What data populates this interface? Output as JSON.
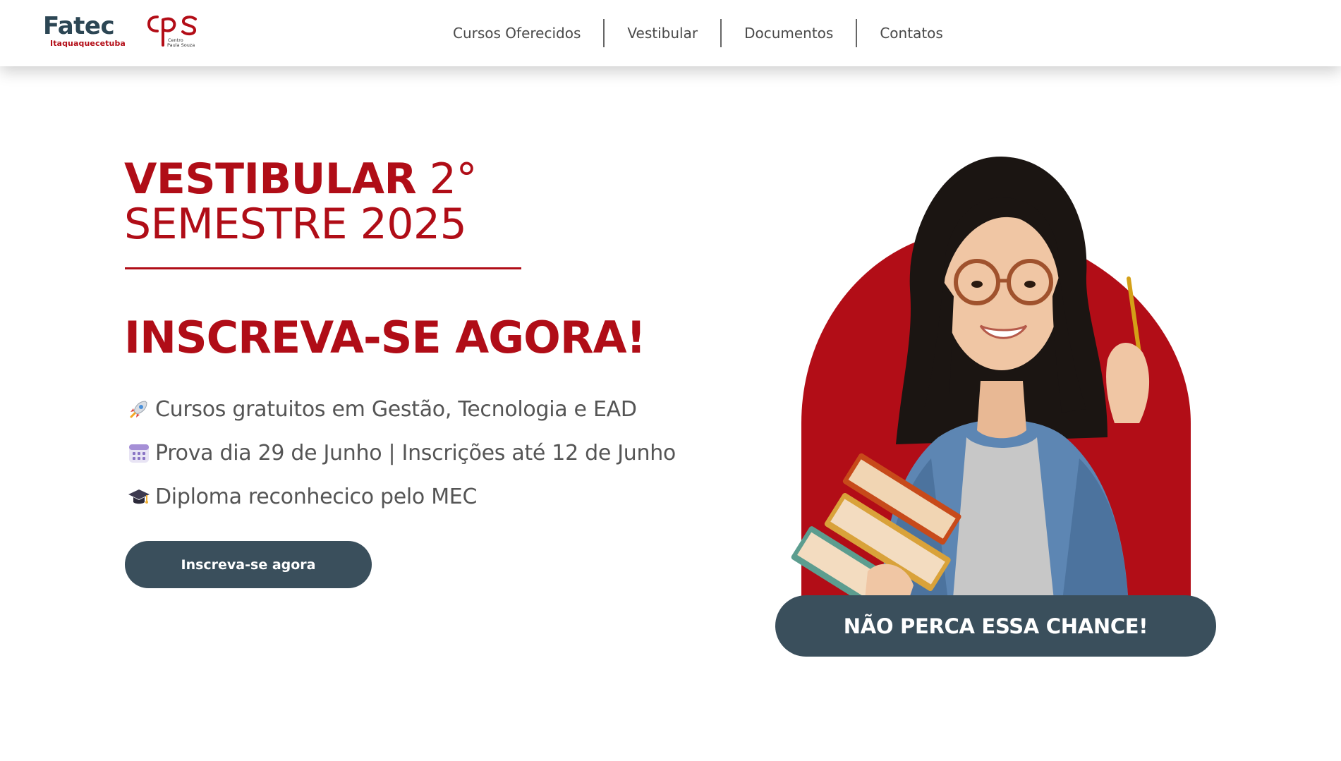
{
  "header": {
    "logo_fatec": {
      "name": "Fatec",
      "city": "Itaquaquecetuba"
    },
    "logo_cps": {
      "mark": "cps",
      "line1": "Centro",
      "line2": "Paula Souza"
    },
    "nav": [
      {
        "label": "Cursos Oferecidos"
      },
      {
        "label": "Vestibular"
      },
      {
        "label": "Documentos"
      },
      {
        "label": "Contatos"
      }
    ]
  },
  "hero": {
    "title_bold": "VESTIBULAR",
    "title_light": " 2°",
    "title_line2": "SEMESTRE 2025",
    "cta_heading": "INSCREVA-SE AGORA!",
    "features": [
      {
        "icon": "rocket-icon",
        "text": "Cursos gratuitos em Gestão, Tecnologia e EAD"
      },
      {
        "icon": "calendar-icon",
        "text": "Prova dia 29 de Junho | Inscrições até 12 de Junho"
      },
      {
        "icon": "graduation-cap-icon",
        "text": "Diploma reconhecico pelo MEC"
      }
    ],
    "button_label": "Inscreva-se agora",
    "chance_label": "NÃO PERCA ESSA CHANCE!"
  },
  "colors": {
    "brand_red": "#b00d17",
    "brand_dark": "#3a4f5c",
    "fatec_blue": "#2c4654",
    "text_gray": "#555555"
  }
}
